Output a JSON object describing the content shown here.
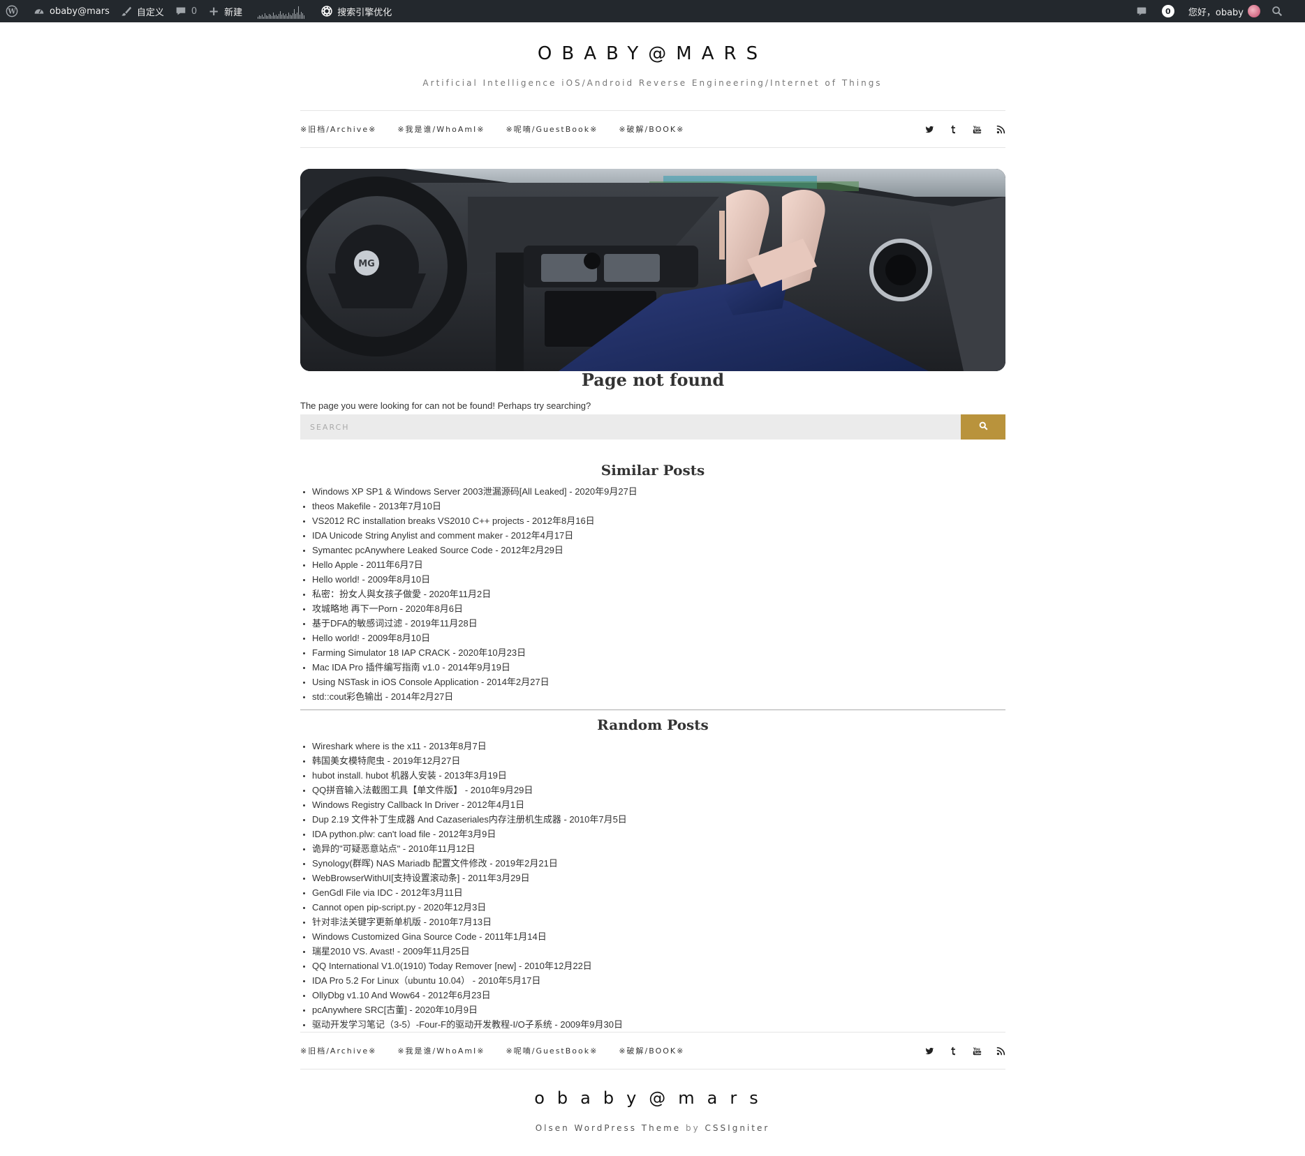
{
  "admin_bar": {
    "site_name": "obaby@mars",
    "customize": "自定义",
    "comments_count": "0",
    "new": "新建",
    "seo": "搜索引擎优化",
    "notifications_count": "0",
    "greeting": "您好，obaby"
  },
  "site": {
    "title": "OBABY@MARS",
    "description": "Artificial Intelligence iOS/Android Reverse Engineering/Internet of Things"
  },
  "nav": {
    "items": [
      "※旧档/Archive※",
      "※我是谁/WhoAmI※",
      "※呢喃/GuestBook※",
      "※破解/BOOK※"
    ],
    "social": [
      "twitter-icon",
      "tumblr-icon",
      "youtube-icon",
      "rss-icon"
    ]
  },
  "main": {
    "heading": "Page not found",
    "message": "The page you were looking for can not be found! Perhaps try searching?",
    "search_placeholder": "SEARCH"
  },
  "similar_posts": {
    "title": "Similar Posts",
    "items": [
      "Windows XP SP1 & Windows Server 2003泄漏源码[All Leaked] - 2020年9月27日",
      "theos Makefile - 2013年7月10日",
      "VS2012 RC installation breaks VS2010 C++ projects - 2012年8月16日",
      "IDA Unicode String Anylist and comment maker - 2012年4月17日",
      "Symantec pcAnywhere Leaked Source Code - 2012年2月29日",
      "Hello Apple - 2011年6月7日",
      "Hello world! - 2009年8月10日",
      "私密：扮女人與女孩子做愛 - 2020年11月2日",
      "攻城略地 再下一Porn - 2020年8月6日",
      "基于DFA的敏感词过滤 - 2019年11月28日",
      "Hello world! - 2009年8月10日",
      "Farming Simulator 18 IAP CRACK - 2020年10月23日",
      "Mac IDA Pro 插件编写指南 v1.0 - 2014年9月19日",
      "Using NSTask in iOS Console Application - 2014年2月27日",
      "std::cout彩色输出 - 2014年2月27日"
    ]
  },
  "random_posts": {
    "title": "Random Posts",
    "items": [
      "Wireshark where is the x11 - 2013年8月7日",
      "韩国美女模特爬虫 - 2019年12月27日",
      "hubot install. hubot 机器人安装 - 2013年3月19日",
      "QQ拼音输入法截图工具【单文件版】 - 2010年9月29日",
      "Windows Registry Callback In Driver - 2012年4月1日",
      "Dup 2.19 文件补丁生成器 And Cazaseriales内存注册机生成器 - 2010年7月5日",
      "IDA python.plw: can't load file - 2012年3月9日",
      "诡异的\"可疑恶意站点\" - 2010年11月12日",
      "Synology(群晖) NAS Mariadb 配置文件修改 - 2019年2月21日",
      "WebBrowserWithUI[支持设置滚动条] - 2011年3月29日",
      "GenGdl File via IDC - 2012年3月11日",
      "Cannot open pip-script.py - 2020年12月3日",
      "针对非法关键字更新单机版 - 2010年7月13日",
      "Windows Customized Gina Source Code - 2011年1月14日",
      "瑞星2010 VS. Avast! - 2009年11月25日",
      "QQ International V1.0(1910) Today Remover [new] - 2010年12月22日",
      "IDA Pro 5.2 For Linux（ubuntu 10.04） - 2010年5月17日",
      "OllyDbg v1.10 And Wow64 - 2012年6月23日",
      "pcAnywhere SRC[古董] - 2020年10月9日",
      "驱动开发学习笔记（3-5）-Four-F的驱动开发教程-I/O子系统 - 2009年9月30日"
    ]
  },
  "footer": {
    "title": "obaby@mars",
    "credit_theme": "Olsen WordPress Theme",
    "credit_by": "by",
    "credit_author": "CSSIgniter"
  },
  "colors": {
    "admin_bar_bg": "#23282d",
    "accent": "#b9933c",
    "search_bg": "#ebebeb"
  }
}
